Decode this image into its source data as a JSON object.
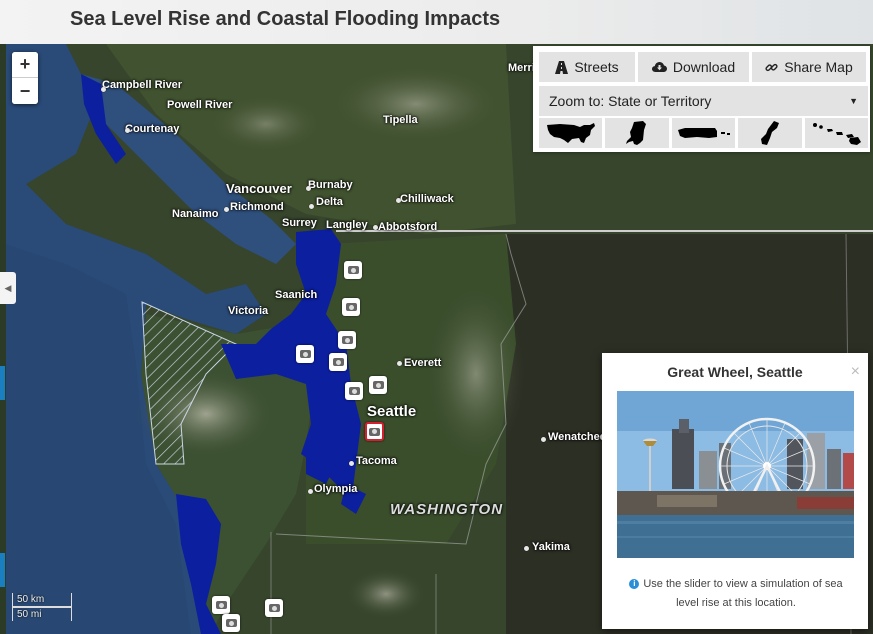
{
  "header": {
    "title": "Sea Level Rise and Coastal Flooding Impacts"
  },
  "zoom": {
    "in_label": "+",
    "out_label": "−"
  },
  "toolbar": {
    "streets_label": "Streets",
    "download_label": "Download",
    "share_label": "Share Map",
    "zoom_to_label": "Zoom to: State or Territory",
    "shapes": [
      "us-mainland-icon",
      "alaska-icon",
      "puerto-rico-icon",
      "guam-icon",
      "hawaii-icon"
    ]
  },
  "map": {
    "places": {
      "campbell_river": "Campbell River",
      "powell_river": "Powell River",
      "courtenay": "Courtenay",
      "tipella": "Tipella",
      "merritt": "Merri",
      "vancouver": "Vancouver",
      "burnaby": "Burnaby",
      "richmond": "Richmond",
      "delta": "Delta",
      "nanaimo": "Nanaimo",
      "surrey": "Surrey",
      "langley": "Langley",
      "abbotsford": "Abbotsford",
      "chilliwack": "Chilliwack",
      "saanich": "Saanich",
      "victoria": "Victoria",
      "everett": "Everett",
      "seattle": "Seattle",
      "tacoma": "Tacoma",
      "olympia": "Olympia",
      "wenatchee": "Wenatchee",
      "yakima": "Yakima",
      "washington": "WASHINGTON"
    }
  },
  "popup": {
    "title": "Great Wheel, Seattle",
    "close": "×",
    "caption": "Use the slider to view a simulation of sea level rise at this location."
  },
  "scale": {
    "km": "50 km",
    "mi": "50 mi"
  },
  "colors": {
    "flood": "#0c1f9e",
    "accent": "#1a7fc1",
    "active_marker": "#d2202f"
  }
}
